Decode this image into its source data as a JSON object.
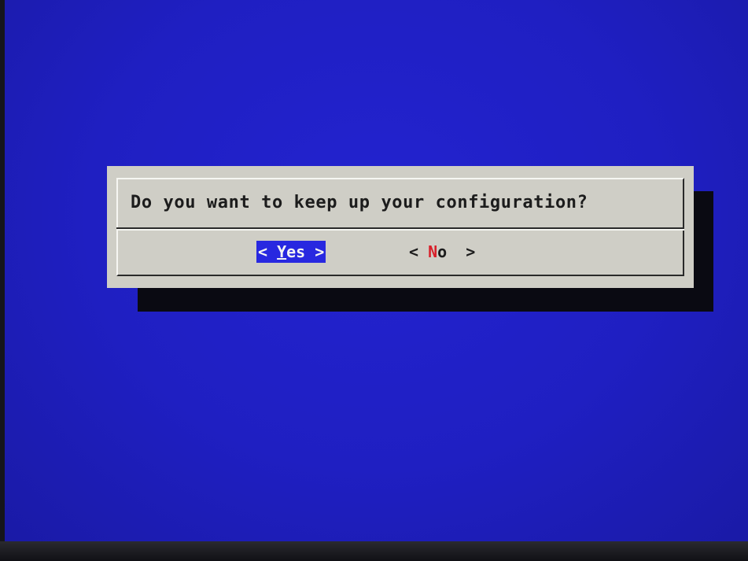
{
  "dialog": {
    "message": "Do you want to keep up your configuration?",
    "buttons": {
      "yes": {
        "left_bracket": "< ",
        "hotkey": "Y",
        "rest": "es",
        "right_bracket": " >"
      },
      "no": {
        "left_bracket": "< ",
        "hotkey": "N",
        "rest": "o",
        "right_bracket": "  >"
      }
    },
    "selected_button": "yes"
  },
  "colors": {
    "screen_background": "#1f1fc2",
    "dialog_background": "#cfcec6",
    "selected_button_background": "#2828e0",
    "hotkey_highlight": "#d8202a",
    "text": "#1c1c1c"
  }
}
